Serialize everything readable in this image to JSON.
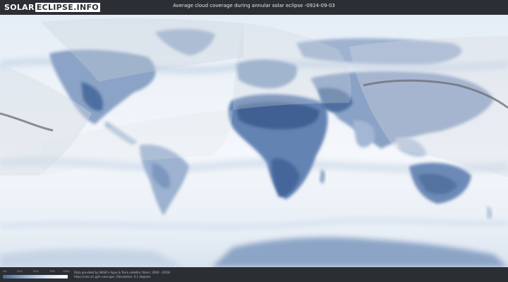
{
  "header": {
    "logo_solar": "SOLAR",
    "logo_eclipse": "ECLIPSE.INFO",
    "title": "Average cloud coverage during annular solar eclipse -0924-09-03"
  },
  "footer": {
    "legend_ticks": [
      "0%",
      "25%",
      "50%",
      "75%",
      "100%"
    ],
    "credit_line1": "Data provided by NASA's Aqua & Terra satellite (Years: 2000 - 2019)",
    "credit_line2": "https://neo.sci.gsfc.nasa.gov | Resolution: 0.1 degrees"
  },
  "colors": {
    "header_bg": "#2b2e33",
    "map_clear": "#f2f6fa",
    "land_clear": "#5f7fae",
    "eclipse_path": "#6b6e73"
  }
}
